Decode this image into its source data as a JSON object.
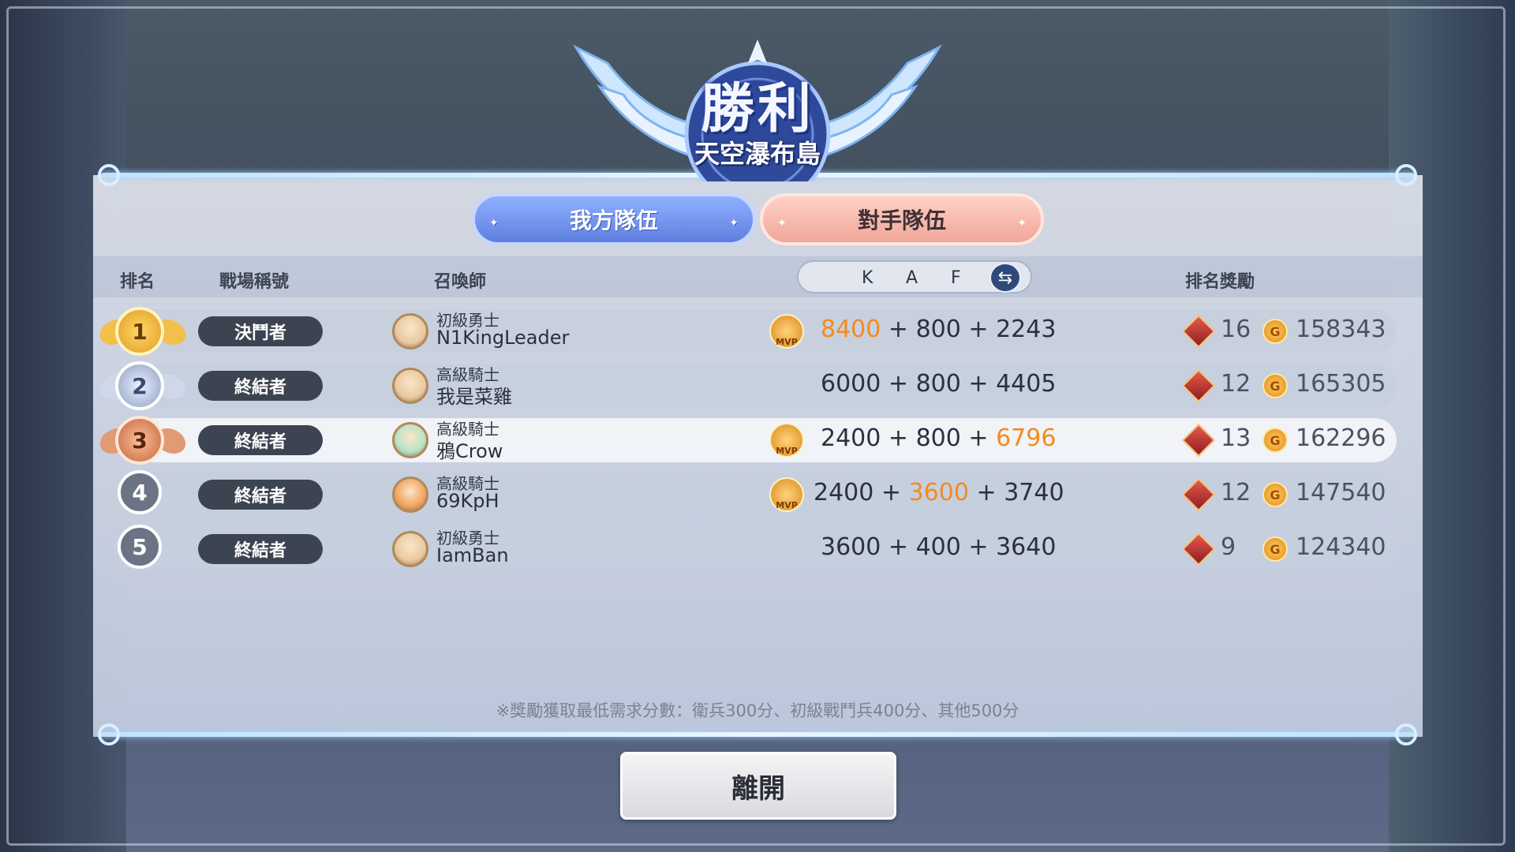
{
  "header": {
    "title": "勝利",
    "map_name": "天空瀑布島"
  },
  "tabs": {
    "ours": "我方隊伍",
    "enemy": "對手隊伍"
  },
  "columns": {
    "rank": "排名",
    "battle_title": "戰場稱號",
    "summoner": "召喚師",
    "k": "K",
    "a": "A",
    "f": "F",
    "reward": "排名獎勵"
  },
  "rows": [
    {
      "rank": "1",
      "medal": "gold",
      "battle_title": "決鬥者",
      "summoner_rank": "初級勇士",
      "summoner_name": "N1KingLeader",
      "mvp": true,
      "k": "8400",
      "a": "800",
      "f": "2243",
      "highlight": "k",
      "gems": "16",
      "coins": "158343"
    },
    {
      "rank": "2",
      "medal": "silver",
      "battle_title": "終結者",
      "summoner_rank": "高級騎士",
      "summoner_name": "我是菜雞",
      "mvp": false,
      "k": "6000",
      "a": "800",
      "f": "4405",
      "highlight": "",
      "gems": "12",
      "coins": "165305"
    },
    {
      "rank": "3",
      "medal": "bronze",
      "battle_title": "終結者",
      "summoner_rank": "高級騎士",
      "summoner_name": "鴉Crow",
      "mvp": true,
      "k": "2400",
      "a": "800",
      "f": "6796",
      "highlight": "f",
      "gems": "13",
      "coins": "162296"
    },
    {
      "rank": "4",
      "medal": "plain",
      "battle_title": "終結者",
      "summoner_rank": "高級騎士",
      "summoner_name": "69KpH",
      "mvp": true,
      "k": "2400",
      "a": "3600",
      "f": "3740",
      "highlight": "a",
      "gems": "12",
      "coins": "147540"
    },
    {
      "rank": "5",
      "medal": "plain",
      "battle_title": "終結者",
      "summoner_rank": "初級勇士",
      "summoner_name": "IamBan",
      "mvp": false,
      "k": "3600",
      "a": "400",
      "f": "3640",
      "highlight": "",
      "gems": "9",
      "coins": "124340"
    }
  ],
  "mvp_label": "MVP",
  "plus": "+",
  "note": "※獎勵獲取最低需求分數：衛兵300分、初級戰鬥兵400分、其他500分",
  "leave_button": "離開",
  "colors": {
    "highlight": "#f28b1e",
    "tab_ours": "#6f8ff0",
    "tab_enemy": "#f5b4a8"
  },
  "icons": {
    "swap": "swap-arrows-icon",
    "gem": "red-gem-icon",
    "coin": "gold-coin-icon",
    "mvp": "mvp-emblem-icon"
  }
}
